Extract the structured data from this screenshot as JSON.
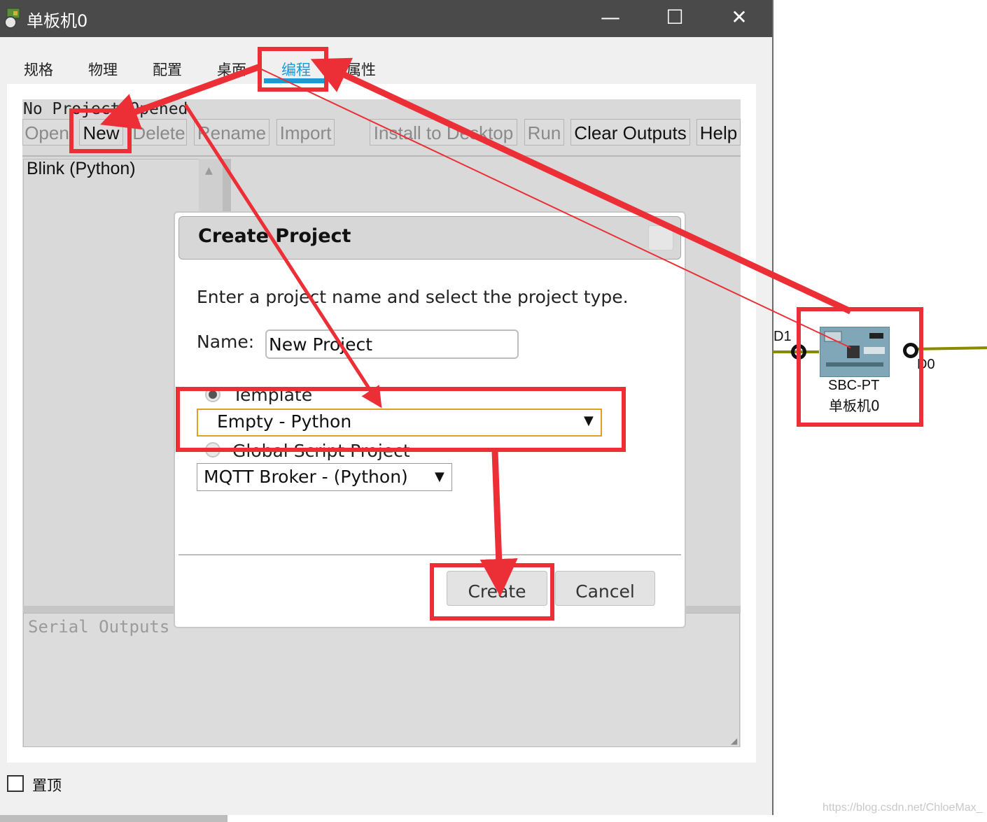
{
  "window": {
    "title": "单板机0",
    "minimize_symbol": "—",
    "maximize_symbol": "☐",
    "close_symbol": "✕",
    "app_icon": "pt-device-icon"
  },
  "tabs": [
    {
      "label": "规格"
    },
    {
      "label": "物理"
    },
    {
      "label": "配置"
    },
    {
      "label": "桌面"
    },
    {
      "label": "编程",
      "active": true
    },
    {
      "label": "属性"
    }
  ],
  "programming": {
    "status": "No Project Opened",
    "toolbar": {
      "open": "Open",
      "new": "New",
      "delete": "Delete",
      "rename": "Rename",
      "import": "Import",
      "install": "Install to Desktop",
      "run": "Run",
      "clear": "Clear Outputs",
      "help": "Help"
    },
    "projects": [
      "Blink (Python)"
    ],
    "serial_placeholder": "Serial Outputs"
  },
  "always_on_top": {
    "label": "置顶",
    "checked": false
  },
  "dialog": {
    "title": "Create Project",
    "instruction": "Enter a project name and select the project type.",
    "name_label": "Name:",
    "name_value": "New Project",
    "template_label": "Template",
    "template_selected": true,
    "template_value": "Empty - Python",
    "global_label": "Global Script Project",
    "global_value": "MQTT Broker - (Python)",
    "create": "Create",
    "cancel": "Cancel",
    "dropdown_arrow": "▼"
  },
  "device": {
    "type": "SBC-PT",
    "name": "单板机0",
    "port_left": "D1",
    "port_right": "D0"
  },
  "watermark": "https://blog.csdn.net/ChloeMax_",
  "colors": {
    "accent": "#1a9ad6",
    "annotation": "#ec2f36",
    "titlebar": "#4a4a4a",
    "wire": "#8a8a00",
    "select_focus": "#e0a020"
  }
}
